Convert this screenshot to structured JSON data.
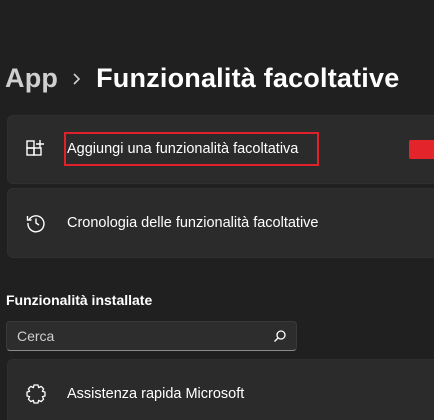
{
  "breadcrumb": {
    "parent": "App",
    "current": "Funzionalità facoltative"
  },
  "actions": {
    "add_label": "Aggiungi una funzionalità facoltativa",
    "history_label": "Cronologia delle funzionalità facoltative"
  },
  "installed": {
    "heading": "Funzionalità installate",
    "search_placeholder": "Cerca",
    "items": [
      {
        "label": "Assistenza rapida Microsoft",
        "icon": "gear-puzzle-icon"
      }
    ]
  },
  "colors": {
    "background": "#202020",
    "card": "#2b2b2b",
    "highlight": "#e0202a",
    "accent": "#e3242b"
  }
}
